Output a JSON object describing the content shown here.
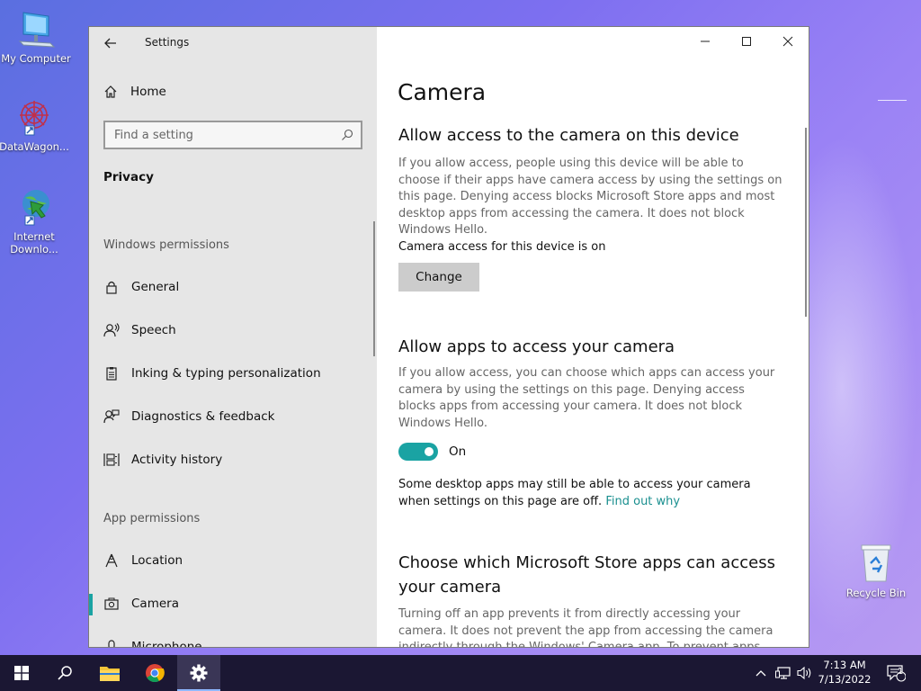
{
  "desktop": {
    "icons": [
      {
        "label": "My Computer"
      },
      {
        "label": "DataWagon..."
      },
      {
        "label": "Internet Downlo..."
      },
      {
        "label": "Recycle Bin"
      }
    ]
  },
  "window": {
    "title": "Settings"
  },
  "sidebar": {
    "home_label": "Home",
    "search_placeholder": "Find a setting",
    "section": "Privacy",
    "group1": "Windows permissions",
    "windows_items": [
      {
        "label": "General",
        "icon": "lock-icon"
      },
      {
        "label": "Speech",
        "icon": "speech-icon"
      },
      {
        "label": "Inking & typing personalization",
        "icon": "clipboard-icon"
      },
      {
        "label": "Diagnostics & feedback",
        "icon": "feedback-icon"
      },
      {
        "label": "Activity history",
        "icon": "activity-icon"
      }
    ],
    "group2": "App permissions",
    "app_items": [
      {
        "label": "Location",
        "icon": "location-icon"
      },
      {
        "label": "Camera",
        "icon": "camera-icon",
        "active": true
      },
      {
        "label": "Microphone",
        "icon": "microphone-icon"
      }
    ]
  },
  "main": {
    "title": "Camera",
    "s1_heading": "Allow access to the camera on this device",
    "s1_desc": "If you allow access, people using this device will be able to choose if their apps have camera access by using the settings on this page. Denying access blocks Microsoft Store apps and most desktop apps from accessing the camera. It does not block Windows Hello.",
    "s1_status": "Camera access for this device is on",
    "change_label": "Change",
    "s2_heading": "Allow apps to access your camera",
    "s2_desc": "If you allow access, you can choose which apps can access your camera by using the settings on this page. Denying access blocks apps from accessing your camera. It does not block Windows Hello.",
    "toggle_state": "On",
    "s2_note": "Some desktop apps may still be able to access your camera when settings on this page are off.",
    "find_out_why": "Find out why",
    "s3_heading": "Choose which Microsoft Store apps can access your camera",
    "s3_desc": "Turning off an app prevents it from directly accessing your camera. It does not prevent the app from accessing the camera indirectly through the Windows' Camera app. To prevent apps from also"
  },
  "taskbar": {
    "time": "7:13 AM",
    "date": "7/13/2022",
    "notification_count": "1"
  },
  "colors": {
    "accent": "#1aa3a3",
    "taskbar": "#1b1733"
  }
}
